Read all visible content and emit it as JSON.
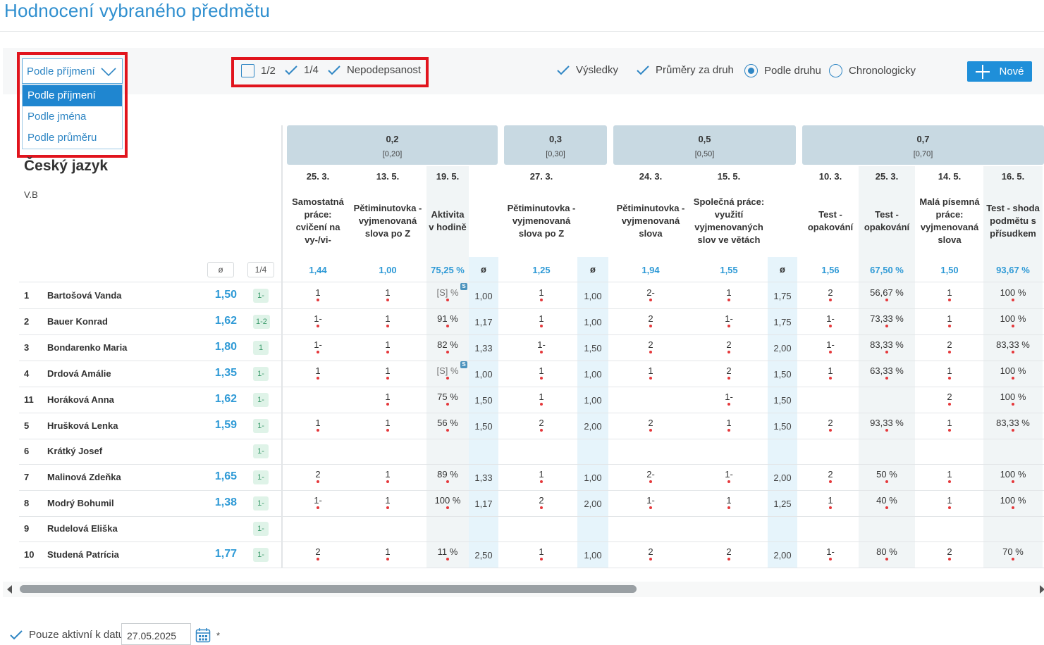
{
  "page": {
    "title": "Hodnocení vybraného předmětu"
  },
  "toolbar": {
    "sort": {
      "selected": "Podle příjmení",
      "options": [
        "Podle příjmení",
        "Podle jména",
        "Podle průměru"
      ]
    },
    "filters": {
      "half": "1/2",
      "quarter": "1/4",
      "unsigned": "Nepodepsanost"
    },
    "view": {
      "results": "Výsledky",
      "avg_by_type": "Průměry za druh",
      "by_type": "Podle druhu",
      "chronological": "Chronologicky"
    },
    "new_button": "Nové"
  },
  "subject": {
    "name": "Český jazyk",
    "class": "V.B"
  },
  "header": {
    "avg_symbol": "ø",
    "quarter_label": "1/4"
  },
  "groups": [
    {
      "weight": "0,2",
      "range": "[0,20]"
    },
    {
      "weight": "0,3",
      "range": "[0,30]"
    },
    {
      "weight": "0,5",
      "range": "[0,50]"
    },
    {
      "weight": "0,7",
      "range": "[0,70]"
    }
  ],
  "columns": [
    {
      "date": "25. 3.",
      "name": "Samostatná práce: cvičení na vy-/vi-",
      "avg": "1,44"
    },
    {
      "date": "13. 5.",
      "name": "Pětiminutovka - vyjmenovaná slova po Z",
      "avg": "1,00"
    },
    {
      "date": "19. 5.",
      "name": "Aktivita v hodině",
      "avg": "75,25 %"
    },
    {
      "date": "27. 3.",
      "name": "Pětiminutovka - vyjmenovaná slova po Z",
      "avg": "1,25"
    },
    {
      "date": "24. 3.",
      "name": "Pětiminutovka - vyjmenovaná slova",
      "avg": "1,94"
    },
    {
      "date": "15. 5.",
      "name": "Společná práce: využití vyjmenovaných slov ve větách",
      "avg": "1,55"
    },
    {
      "date": "10. 3.",
      "name": "Test - opakování",
      "avg": "1,56"
    },
    {
      "date": "25. 3.",
      "name": "Test - opakování",
      "avg": "67,50 %"
    },
    {
      "date": "14. 5.",
      "name": "Malá písemná práce: vyjmenovaná slova",
      "avg": "1,50"
    },
    {
      "date": "16. 5.",
      "name": "Test - shoda podmětu s přísudkem",
      "avg": "93,67 %"
    }
  ],
  "rows": [
    {
      "num": "1",
      "name": "Bartošová Vanda",
      "avg": "1,50",
      "badge": "1-",
      "c": [
        "1",
        "1",
        "[S] %",
        "1",
        "2-",
        "1",
        "2",
        "56,67 %",
        "1",
        "100 %"
      ],
      "s": [
        false,
        false,
        true,
        false,
        false,
        false,
        false,
        false,
        false,
        false
      ],
      "a": [
        "1,00",
        "1,00",
        "1,75"
      ]
    },
    {
      "num": "2",
      "name": "Bauer Konrad",
      "avg": "1,62",
      "badge": "1-2",
      "c": [
        "1-",
        "1",
        "91 %",
        "1",
        "2",
        "1-",
        "1-",
        "73,33 %",
        "1",
        "100 %"
      ],
      "s": [
        false,
        false,
        false,
        false,
        false,
        false,
        false,
        false,
        false,
        false
      ],
      "a": [
        "1,17",
        "1,00",
        "1,75"
      ]
    },
    {
      "num": "3",
      "name": "Bondarenko Maria",
      "avg": "1,80",
      "badge": "1",
      "c": [
        "1-",
        "1",
        "82 %",
        "1-",
        "2",
        "2",
        "1-",
        "83,33 %",
        "2",
        "83,33 %"
      ],
      "s": [
        false,
        false,
        false,
        false,
        false,
        false,
        false,
        false,
        false,
        false
      ],
      "a": [
        "1,33",
        "1,50",
        "2,00"
      ]
    },
    {
      "num": "4",
      "name": "Drdová Amálie",
      "avg": "1,35",
      "badge": "1-",
      "c": [
        "1",
        "1",
        "[S] %",
        "1",
        "1",
        "2",
        "1",
        "63,33 %",
        "1",
        "100 %"
      ],
      "s": [
        false,
        false,
        true,
        false,
        false,
        false,
        false,
        false,
        false,
        false
      ],
      "a": [
        "1,00",
        "1,00",
        "1,50"
      ]
    },
    {
      "num": "11",
      "name": "Horáková Anna",
      "avg": "1,62",
      "badge": "1-",
      "c": [
        "",
        "1",
        "75 %",
        "1",
        "",
        "1-",
        "",
        "",
        "2",
        "100 %"
      ],
      "s": [
        false,
        false,
        false,
        false,
        false,
        false,
        false,
        false,
        false,
        false
      ],
      "a": [
        "1,50",
        "1,00",
        "1,50"
      ]
    },
    {
      "num": "5",
      "name": "Hrušková Lenka",
      "avg": "1,59",
      "badge": "1-",
      "c": [
        "1",
        "1",
        "56 %",
        "2",
        "2",
        "1",
        "2",
        "93,33 %",
        "1",
        "83,33 %"
      ],
      "s": [
        false,
        false,
        false,
        false,
        false,
        false,
        false,
        false,
        false,
        false
      ],
      "a": [
        "1,50",
        "2,00",
        "1,50"
      ]
    },
    {
      "num": "6",
      "name": "Krátký Josef",
      "avg": "",
      "badge": "1-",
      "c": [
        "",
        "",
        "",
        "",
        "",
        "",
        "",
        "",
        "",
        ""
      ],
      "s": [
        false,
        false,
        false,
        false,
        false,
        false,
        false,
        false,
        false,
        false
      ],
      "a": [
        "",
        "",
        ""
      ]
    },
    {
      "num": "7",
      "name": "Malinová Zdeňka",
      "avg": "1,65",
      "badge": "1-",
      "c": [
        "2",
        "1",
        "89 %",
        "1",
        "2-",
        "1-",
        "2",
        "50 %",
        "1",
        "100 %"
      ],
      "s": [
        false,
        false,
        false,
        false,
        false,
        false,
        false,
        false,
        false,
        false
      ],
      "a": [
        "1,33",
        "1,00",
        "2,00"
      ]
    },
    {
      "num": "8",
      "name": "Modrý Bohumil",
      "avg": "1,38",
      "badge": "1-",
      "c": [
        "1-",
        "1",
        "100 %",
        "2",
        "1-",
        "1",
        "1",
        "40 %",
        "1",
        "100 %"
      ],
      "s": [
        false,
        false,
        false,
        false,
        false,
        false,
        false,
        false,
        false,
        false
      ],
      "a": [
        "1,17",
        "2,00",
        "1,25"
      ]
    },
    {
      "num": "9",
      "name": "Rudelová Eliška",
      "avg": "",
      "badge": "1-",
      "c": [
        "",
        "",
        "",
        "",
        "",
        "",
        "",
        "",
        "",
        ""
      ],
      "s": [
        false,
        false,
        false,
        false,
        false,
        false,
        false,
        false,
        false,
        false
      ],
      "a": [
        "",
        "",
        ""
      ]
    },
    {
      "num": "10",
      "name": "Studená Patrícia",
      "avg": "1,77",
      "badge": "1-",
      "c": [
        "2",
        "1",
        "11 %",
        "1",
        "2",
        "2",
        "1-",
        "80 %",
        "2",
        "70 %"
      ],
      "s": [
        false,
        false,
        false,
        false,
        false,
        false,
        false,
        false,
        false,
        false
      ],
      "a": [
        "2,50",
        "1,00",
        "2,00"
      ]
    }
  ],
  "s_badge": "S",
  "footer": {
    "active_label": "Pouze aktivní k datu",
    "date": "27.05.2025",
    "asterisk": "*"
  }
}
